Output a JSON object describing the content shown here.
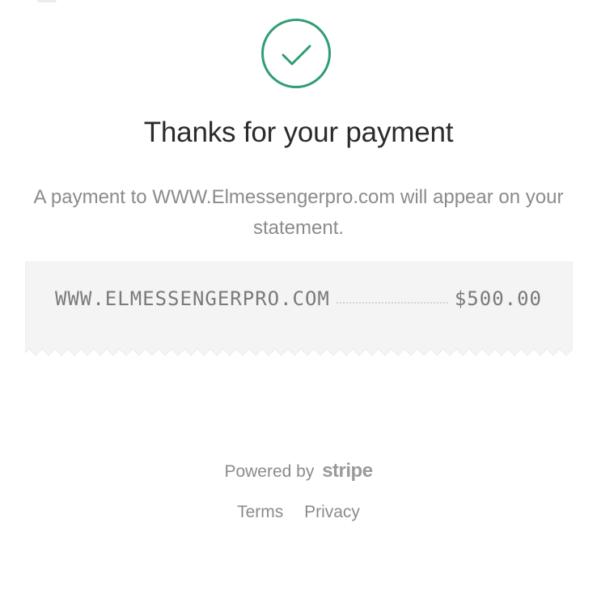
{
  "header": {
    "title": "Thanks for your payment"
  },
  "status": {
    "icon": "check-circle-icon",
    "color": "#2e9e72"
  },
  "message": {
    "text": "A payment to WWW.Elmessengerpro.com will appear on your statement."
  },
  "receipt": {
    "merchant": "WWW.ELMESSENGERPRO.COM",
    "amount": "$500.00"
  },
  "footer": {
    "powered_by": "Powered by",
    "brand": "stripe",
    "links": [
      "Terms",
      "Privacy"
    ]
  }
}
